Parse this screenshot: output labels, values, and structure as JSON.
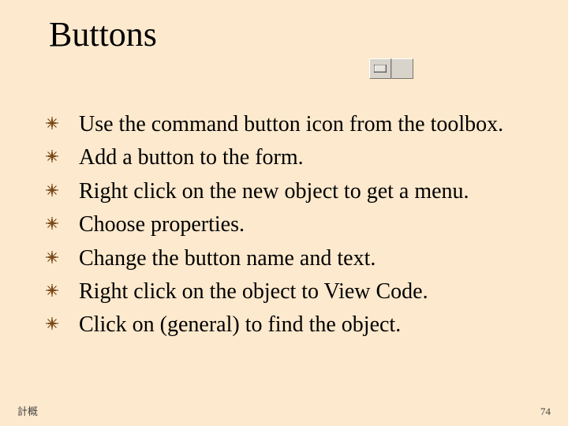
{
  "title": "Buttons",
  "toolbox_icon": "command-button-icon",
  "bullets": [
    "Use the command button icon from the toolbox.",
    "Add a button to the form.",
    "Right click on the new object to get a menu.",
    "Choose properties.",
    "Change the button name and text.",
    "Right click on the object to View Code.",
    "Click on (general) to find the object."
  ],
  "footer": {
    "left": "計概",
    "right": "74"
  }
}
